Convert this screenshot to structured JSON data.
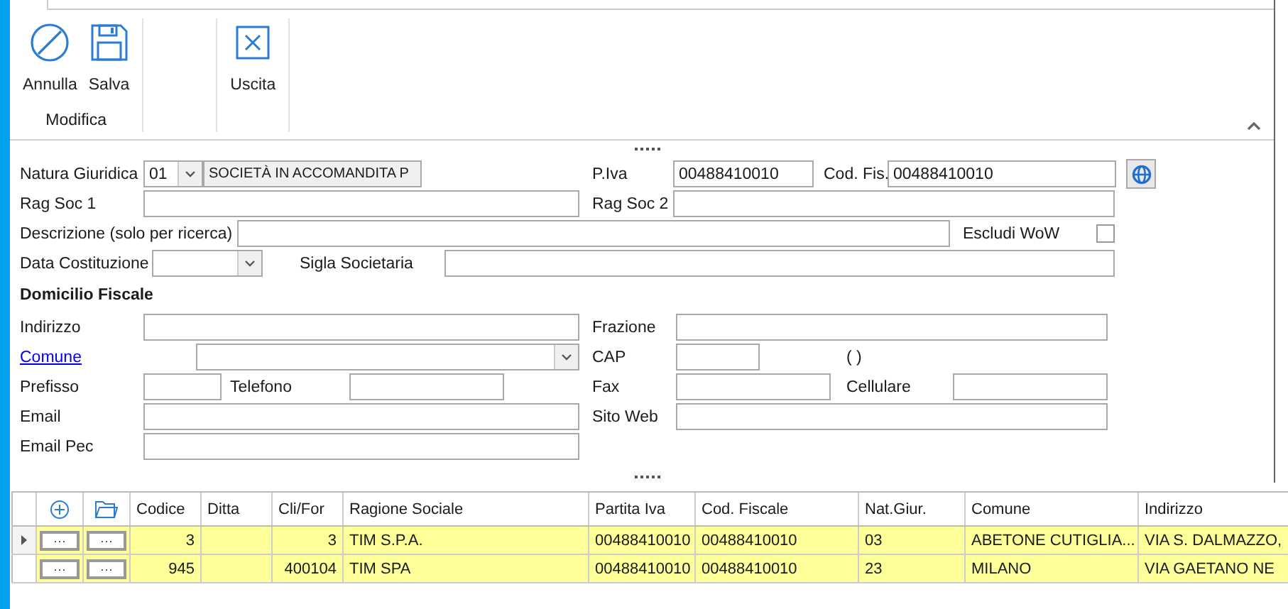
{
  "ribbon": {
    "groups": [
      {
        "label": "Modifica",
        "buttons": [
          {
            "label": "Annulla",
            "kind": "cancel"
          },
          {
            "label": "Salva",
            "kind": "save"
          }
        ]
      },
      {
        "buttons": [
          {
            "label": "Uscita",
            "kind": "exit"
          }
        ]
      }
    ]
  },
  "form": {
    "natura_giuridica": {
      "label": "Natura Giuridica",
      "code": "01",
      "description": "SOCIETÀ IN ACCOMANDITA P"
    },
    "p_iva": {
      "label": "P.Iva",
      "value": "00488410010"
    },
    "cod_fis": {
      "label": "Cod. Fis.",
      "value": "00488410010"
    },
    "rag_soc_1": {
      "label": "Rag Soc 1"
    },
    "rag_soc_2": {
      "label": "Rag Soc 2"
    },
    "descrizione": {
      "label": "Descrizione (solo per ricerca)"
    },
    "escludi_wow": {
      "label": "Escludi WoW",
      "checked": false
    },
    "data_costituzione": {
      "label": "Data Costituzione"
    },
    "sigla_societaria": {
      "label": "Sigla Societaria"
    },
    "section_title": "Domicilio Fiscale",
    "indirizzo": {
      "label": "Indirizzo"
    },
    "frazione": {
      "label": "Frazione"
    },
    "comune": {
      "label": "Comune"
    },
    "cap": {
      "label": "CAP"
    },
    "provincia": "( )",
    "prefisso": {
      "label": "Prefisso"
    },
    "telefono": {
      "label": "Telefono"
    },
    "fax": {
      "label": "Fax"
    },
    "cellulare": {
      "label": "Cellulare"
    },
    "email": {
      "label": "Email"
    },
    "sito_web": {
      "label": "Sito Web"
    },
    "email_pec": {
      "label": "Email Pec"
    }
  },
  "table": {
    "columns": [
      "Codice",
      "Ditta",
      "Cli/For",
      "Ragione Sociale",
      "Partita Iva",
      "Cod. Fiscale",
      "Nat.Giur.",
      "Comune",
      "Indirizzo"
    ],
    "rows": [
      {
        "current": true,
        "buttons": [
          "···",
          "···"
        ],
        "cells": [
          "3",
          "",
          "3",
          "TIM S.P.A.",
          "00488410010",
          "00488410010",
          "03",
          "ABETONE CUTIGLIA...",
          "VIA S. DALMAZZO,"
        ]
      },
      {
        "current": false,
        "buttons": [
          "···",
          "···"
        ],
        "cells": [
          "945",
          "",
          "400104",
          "TIM SPA",
          "00488410010",
          "00488410010",
          "23",
          "MILANO",
          "VIA GAETANO NE"
        ]
      }
    ]
  }
}
